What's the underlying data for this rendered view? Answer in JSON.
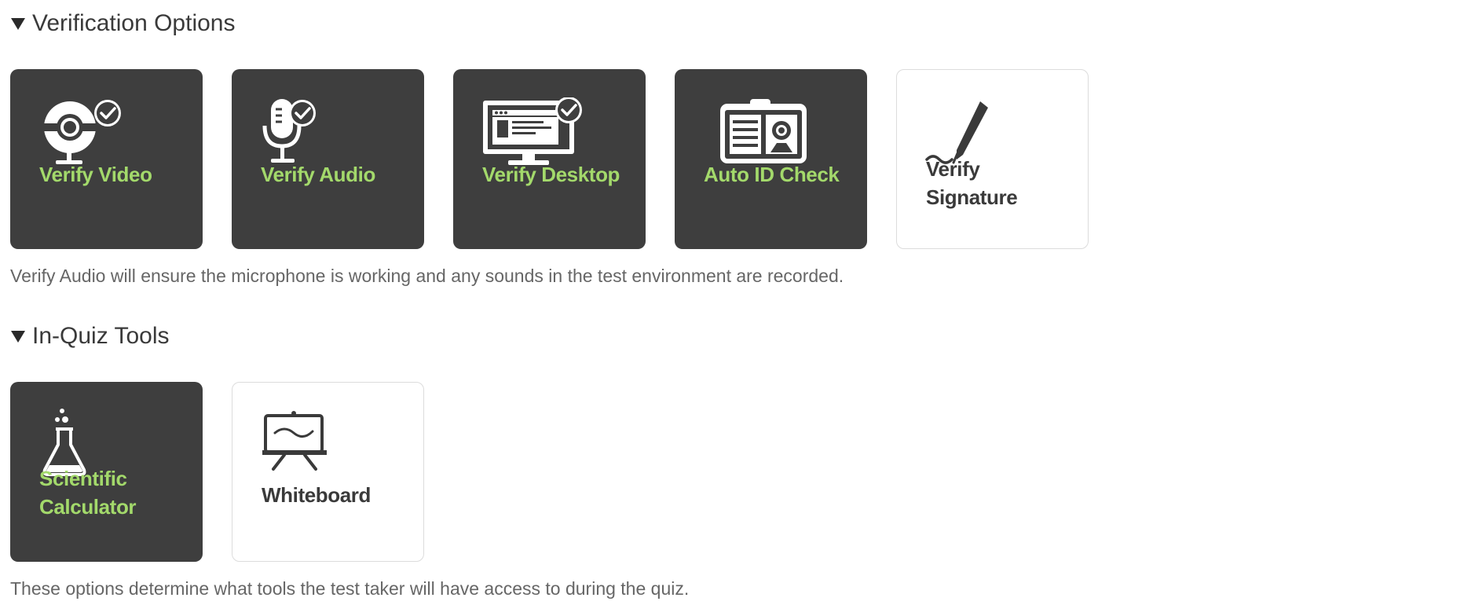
{
  "verification": {
    "title": "Verification Options",
    "tiles": [
      {
        "label": "Verify Video",
        "state": "enabled",
        "icon": "webcam-icon"
      },
      {
        "label": "Verify Audio",
        "state": "enabled",
        "icon": "microphone-icon"
      },
      {
        "label": "Verify Desktop",
        "state": "enabled",
        "icon": "monitor-icon"
      },
      {
        "label": "Auto ID Check",
        "state": "enabled",
        "icon": "id-card-icon"
      },
      {
        "label_line1": "Verify",
        "label_line2": "Signature",
        "state": "disabled",
        "icon": "pen-signature-icon"
      }
    ],
    "description": "Verify Audio will ensure the microphone is working and any sounds in the test environment are recorded."
  },
  "tools": {
    "title": "In-Quiz Tools",
    "tiles": [
      {
        "label_line1": "Scientific",
        "label_line2": "Calculator",
        "state": "enabled",
        "icon": "flask-icon"
      },
      {
        "label": "Whiteboard",
        "state": "disabled",
        "icon": "whiteboard-icon"
      }
    ],
    "description": "These options determine what tools the test taker will have access to during the quiz."
  },
  "colors": {
    "tile_active_bg": "#3e3e3e",
    "tile_active_text": "#a3d96b",
    "tile_inactive_bg": "#ffffff",
    "tile_inactive_text": "#3a3a3a"
  }
}
